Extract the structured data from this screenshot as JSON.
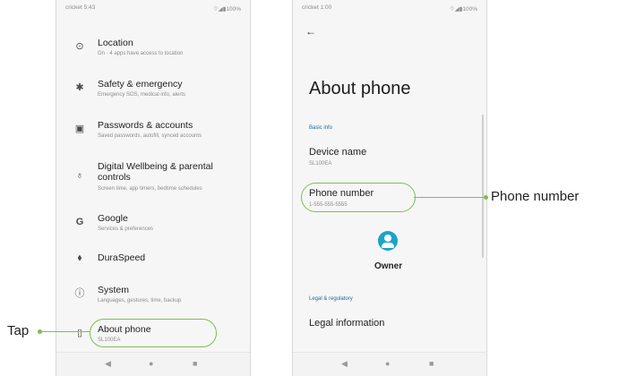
{
  "phone1": {
    "status": {
      "carrier": "cricket 5:43",
      "icons": "⌔◢▮100%"
    },
    "items": [
      {
        "title": "Location",
        "subtitle": "On · 4 apps have access to location",
        "icon": "location-pin-icon",
        "glyph": "⊙"
      },
      {
        "title": "Safety & emergency",
        "subtitle": "Emergency SOS, medical info, alerts",
        "icon": "asterisk-icon",
        "glyph": "✱"
      },
      {
        "title": "Passwords & accounts",
        "subtitle": "Saved passwords, autofill, synced accounts",
        "icon": "account-box-icon",
        "glyph": "▣"
      },
      {
        "title": "Digital Wellbeing & parental controls",
        "subtitle": "Screen time, app timers, bedtime schedules",
        "icon": "wellbeing-icon",
        "glyph": "♁"
      },
      {
        "title": "Google",
        "subtitle": "Services & preferences",
        "icon": "google-icon",
        "glyph": "G"
      },
      {
        "title": "DuraSpeed",
        "subtitle": "",
        "icon": "rocket-icon",
        "glyph": "⬧"
      },
      {
        "title": "System",
        "subtitle": "Languages, gestures, time, backup",
        "icon": "info-icon",
        "glyph": "ⓘ"
      },
      {
        "title": "About phone",
        "subtitle": "SL100EA",
        "icon": "phone-icon",
        "glyph": "▯"
      }
    ]
  },
  "phone2": {
    "status": {
      "carrier": "cricket 1:00",
      "icons": "⌔◢▮100%"
    },
    "back_glyph": "←",
    "title": "About phone",
    "basic_info_header": "Basic info",
    "device_name_title": "Device name",
    "device_name_value": "SL100EA",
    "phone_number_title": "Phone number",
    "phone_number_value": "1-555-555-5555",
    "owner_label": "Owner",
    "legal_header": "Legal & regulatory",
    "legal_title": "Legal information"
  },
  "nav": {
    "back": "◀",
    "home": "●",
    "recents": "■"
  },
  "callouts": {
    "tap": "Tap",
    "phone_number": "Phone number"
  },
  "colors": {
    "accent": "#7cc04e",
    "link": "#1a6d9c",
    "avatar": "#1aa4c8"
  }
}
